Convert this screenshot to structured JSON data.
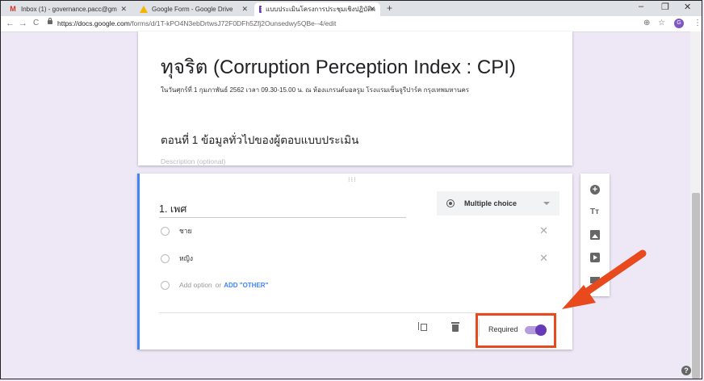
{
  "browser": {
    "tabs": [
      {
        "label": "Inbox (1) - governance.pacc@gm",
        "icon": "gmail-icon"
      },
      {
        "label": "Google Form - Google Drive",
        "icon": "drive-icon"
      },
      {
        "label": "แบบประเมินโครงการประชุมเชิงปฏิบัติก",
        "icon": "forms-icon"
      }
    ],
    "new_tab": "+",
    "url_host": "https://docs.google.com",
    "url_path": "/forms/d/1T-kPO4N3ebDrtwsJ72F0DFh5Zfj2Ounsedwy5QBe--4/edit",
    "profile_initial": "G"
  },
  "form": {
    "title": "ทุจริต (Corruption Perception Index : CPI)",
    "description": "ในวันศุกร์ที่ 1 กุมภาพันธ์ 2562 เวลา 09.30-15.00 น. ณ ห้องแกรนด์บอลรูม โรงแรมเซ็นจูรีปาร์ค กรุงเทพมหานคร",
    "section_title": "ตอนที่ 1 ข้อมูลทั่วไปของผู้ตอบแบบประเมิน",
    "section_desc_placeholder": "Description (optional)"
  },
  "question": {
    "title": "1. เพศ",
    "type_label": "Multiple choice",
    "options": [
      "ชาย",
      "หญิง"
    ],
    "add_option": "Add option",
    "or_text": "or",
    "add_other": "ADD \"OTHER\"",
    "required_label": "Required",
    "required_on": true
  },
  "colors": {
    "accent": "#673ab7",
    "annotation": "#e8491d",
    "active_border": "#4285f4"
  }
}
